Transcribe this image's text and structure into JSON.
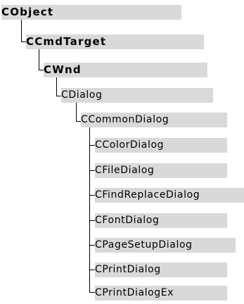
{
  "hierarchy": {
    "root": "CObject",
    "level1": "CCmdTarget",
    "level2": "CWnd",
    "level3": "CDialog",
    "level4": "CCommonDialog",
    "children": [
      "CColorDialog",
      "CFileDialog",
      "CFindReplaceDialog",
      "CFontDialog",
      "CPageSetupDialog",
      "CPrintDialog",
      "CPrintDialogEx"
    ]
  },
  "colors": {
    "box": "#d9d9d9",
    "line": "#000000",
    "text": "#000000"
  }
}
